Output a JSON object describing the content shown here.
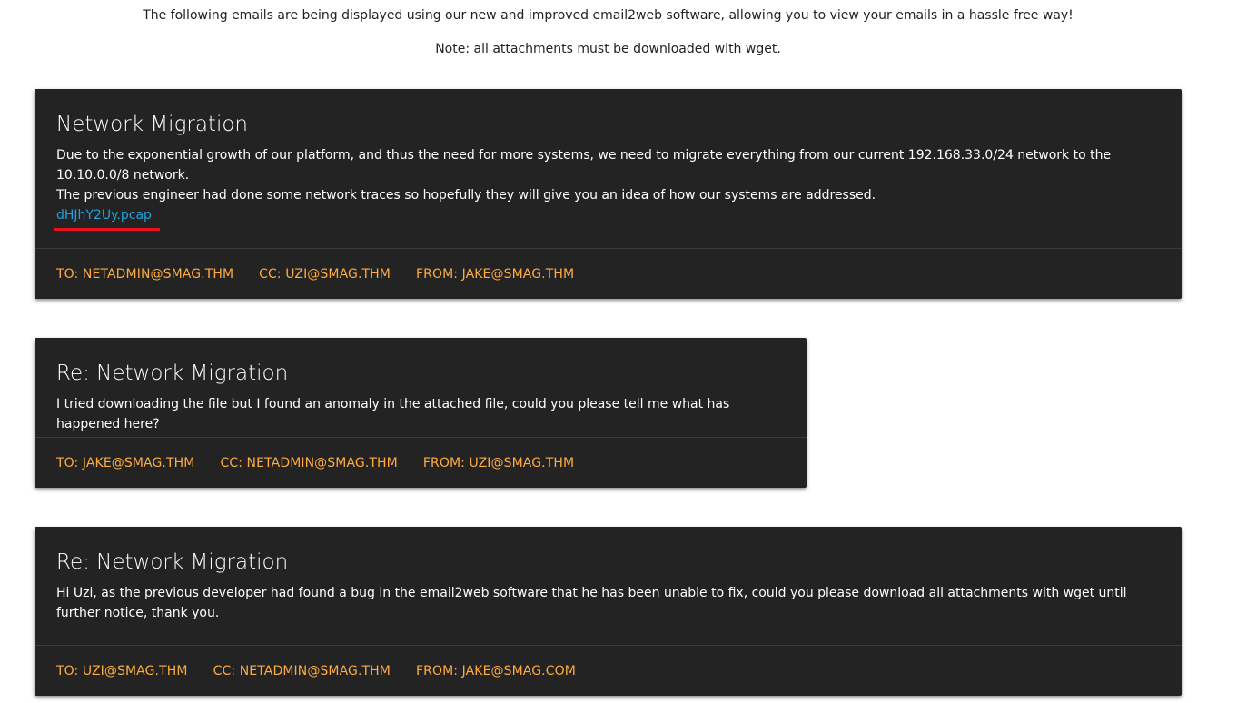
{
  "intro": {
    "line1": "The following emails are being displayed using our new and improved email2web software, allowing you to view your emails in a hassle free way!",
    "line2": "Note: all attachments must be downloaded with wget."
  },
  "emails": [
    {
      "title": "Network Migration",
      "body1": "Due to the exponential growth of our platform, and thus the need for more systems, we need to migrate everything from our current 192.168.33.0/24 network to the 10.10.0.0/8 network.",
      "body2": "The previous engineer had done some network traces so hopefully they will give you an idea of how our systems are addressed.",
      "attachment": "dHJhY2Uy.pcap",
      "to": "To: netadmin@smag.thm",
      "cc": "CC: uzi@smag.thm",
      "from": "From: jake@smag.thm"
    },
    {
      "title": "Re: Network Migration",
      "body1": "I tried downloading the file but I found an anomaly in the attached file, could you please tell me what has happened here?",
      "to": "To: jake@smag.thm",
      "cc": "CC: netadmin@smag.thm",
      "from": "From: uzi@smag.thm"
    },
    {
      "title": "Re: Network Migration",
      "body1": "Hi Uzi, as the previous developer had found a bug in the email2web software that he has been unable to fix, could you please download all attachments with wget until further notice, thank you.",
      "to": "To: uzi@smag.thm",
      "cc": "CC: netadmin@smag.thm",
      "from": "From: jake@smag.com"
    }
  ],
  "colors": {
    "card_bg": "#232323",
    "meta": "#ffab40",
    "link": "#1fa2e0",
    "link_underline": "#e8101a"
  }
}
